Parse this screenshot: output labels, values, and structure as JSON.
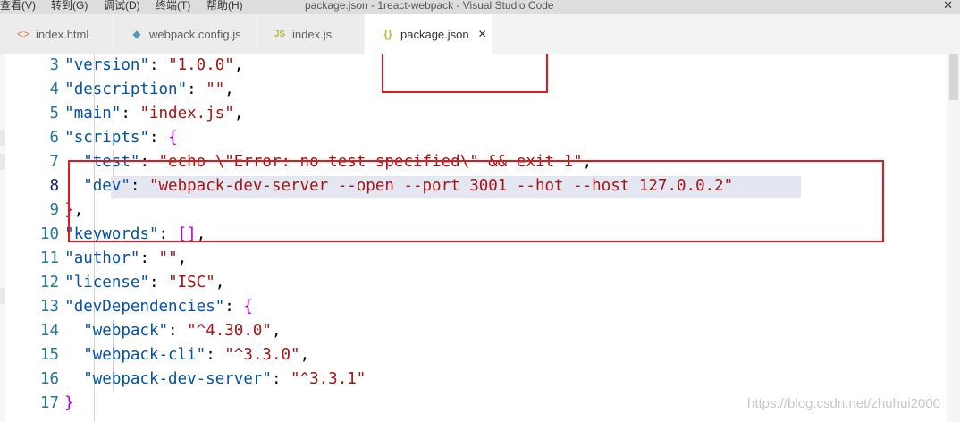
{
  "menubar": {
    "items": [
      "查看(V)",
      "转到(G)",
      "调试(D)",
      "终端(T)",
      "帮助(H)"
    ],
    "window_title": "package.json - 1react-webpack - Visual Studio Code",
    "close_glyph": "✕"
  },
  "tabs": [
    {
      "label": "index.html",
      "icon": "html-file-icon",
      "glyph": "<>",
      "color": "#e37933"
    },
    {
      "label": "webpack.config.js",
      "icon": "webpack-icon",
      "glyph": "◆",
      "color": "#519aba"
    },
    {
      "label": "index.js",
      "icon": "javascript-file-icon",
      "glyph": "JS",
      "color": "#cbcb41"
    },
    {
      "label": "package.json",
      "icon": "json-file-icon",
      "glyph": "{}",
      "color": "#cbcb41",
      "close": "✕",
      "active": true
    }
  ],
  "editor": {
    "lines": [
      {
        "n": "3",
        "text": "    \"version\": \"1.0.0\","
      },
      {
        "n": "4",
        "text": "    \"description\": \"\","
      },
      {
        "n": "5",
        "text": "    \"main\": \"index.js\","
      },
      {
        "n": "6",
        "text": "    \"scripts\": {"
      },
      {
        "n": "7",
        "text": "      \"test\": \"echo \\\"Error: no test specified\\\" && exit 1\","
      },
      {
        "n": "8",
        "text": "      \"dev\": \"webpack-dev-server --open --port 3001 --hot --host 127.0.0.2\"",
        "current": true
      },
      {
        "n": "9",
        "text": "    },"
      },
      {
        "n": "10",
        "text": "    \"keywords\": [],"
      },
      {
        "n": "11",
        "text": "    \"author\": \"\","
      },
      {
        "n": "12",
        "text": "    \"license\": \"ISC\","
      },
      {
        "n": "13",
        "text": "    \"devDependencies\": {"
      },
      {
        "n": "14",
        "text": "      \"webpack\": \"^4.30.0\","
      },
      {
        "n": "15",
        "text": "      \"webpack-cli\": \"^3.3.0\","
      },
      {
        "n": "16",
        "text": "      \"webpack-dev-server\": \"^3.3.1\""
      },
      {
        "n": "17",
        "text": "    }"
      }
    ]
  },
  "watermark": "https://blog.csdn.net/zhuhui2000",
  "colors": {
    "annotation_red": "#e0191f",
    "json_key": "#0451a5",
    "json_string": "#a31515",
    "bracket": "#af00db"
  }
}
